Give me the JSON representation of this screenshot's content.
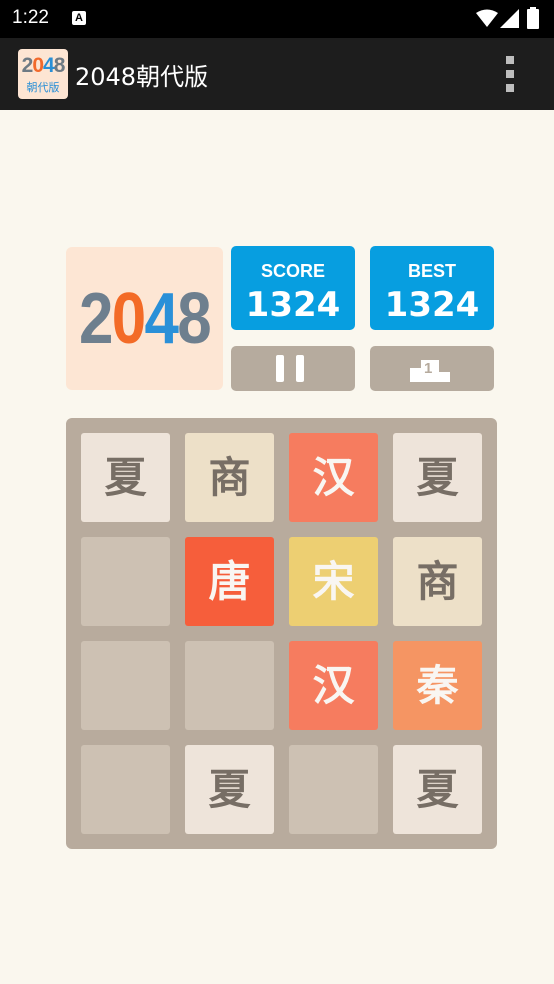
{
  "status_bar": {
    "time": "1:22",
    "notification_badge": "A"
  },
  "app_bar": {
    "icon_digits": [
      "2",
      "0",
      "4",
      "8"
    ],
    "icon_subtitle": "朝代版",
    "title": "2048朝代版",
    "menu_icon": "overflow-menu-icon"
  },
  "logo": {
    "digits": [
      "2",
      "0",
      "4",
      "8"
    ],
    "colors": [
      "#6e7f8e",
      "#f36b27",
      "#2a90d8",
      "#6e7f8e"
    ]
  },
  "score": {
    "label": "SCORE",
    "value": "1324"
  },
  "best": {
    "label": "BEST",
    "value": "1324"
  },
  "controls": {
    "pause_icon": "pause-icon",
    "leaderboard_icon": "podium-icon",
    "leaderboard_number": "1"
  },
  "colors": {
    "accent": "#079ee0",
    "board": "#b8ab9d",
    "empty_cell": "#cdc1b3",
    "background": "#faf7ee"
  },
  "board": {
    "rows": [
      [
        {
          "text": "夏",
          "bg": "#eee4da",
          "fg": "#776e65"
        },
        {
          "text": "商",
          "bg": "#ede0c8",
          "fg": "#776e65"
        },
        {
          "text": "汉",
          "bg": "#f67c5f",
          "fg": "#f9f6f2"
        },
        {
          "text": "夏",
          "bg": "#eee4da",
          "fg": "#776e65"
        }
      ],
      [
        {
          "text": "",
          "bg": "#cdc1b3",
          "fg": "#776e65"
        },
        {
          "text": "唐",
          "bg": "#f65e3b",
          "fg": "#f9f6f2"
        },
        {
          "text": "宋",
          "bg": "#edcf72",
          "fg": "#f9f6f2"
        },
        {
          "text": "商",
          "bg": "#ede0c8",
          "fg": "#776e65"
        }
      ],
      [
        {
          "text": "",
          "bg": "#cdc1b3",
          "fg": "#776e65"
        },
        {
          "text": "",
          "bg": "#cdc1b3",
          "fg": "#776e65"
        },
        {
          "text": "汉",
          "bg": "#f67c5f",
          "fg": "#f9f6f2"
        },
        {
          "text": "秦",
          "bg": "#f59563",
          "fg": "#f9f6f2"
        }
      ],
      [
        {
          "text": "",
          "bg": "#cdc1b3",
          "fg": "#776e65"
        },
        {
          "text": "夏",
          "bg": "#eee4da",
          "fg": "#776e65"
        },
        {
          "text": "",
          "bg": "#cdc1b3",
          "fg": "#776e65"
        },
        {
          "text": "夏",
          "bg": "#eee4da",
          "fg": "#776e65"
        }
      ]
    ]
  }
}
